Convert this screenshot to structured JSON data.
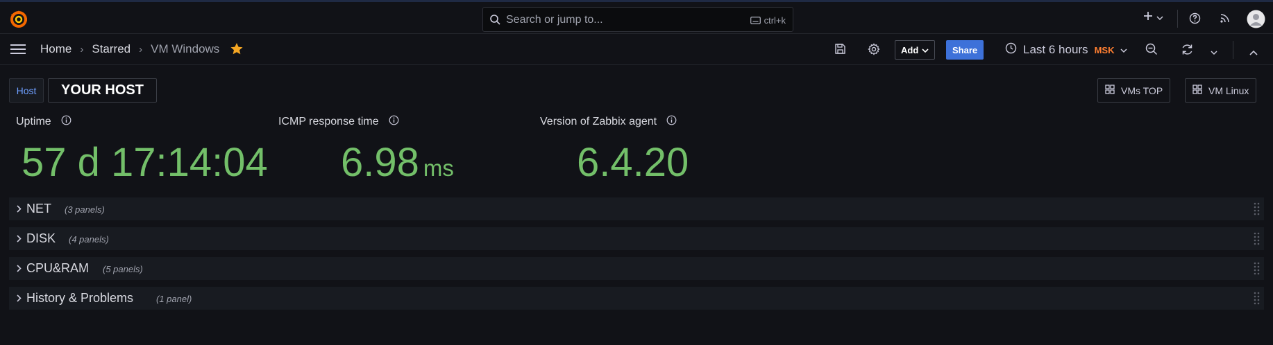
{
  "topbar": {
    "search_placeholder": "Search or jump to...",
    "search_shortcut": "ctrl+k"
  },
  "breadcrumb": {
    "items": [
      "Home",
      "Starred",
      "VM Windows"
    ]
  },
  "toolbar": {
    "add_label": "Add",
    "share_label": "Share",
    "time_range": "Last 6 hours",
    "timezone": "MSK"
  },
  "variables": {
    "host_label": "Host",
    "host_value": "YOUR HOST"
  },
  "links": {
    "vms_top": "VMs TOP",
    "vm_linux": "VM Linux"
  },
  "stats": [
    {
      "title": "Uptime",
      "value": "57 d 17:14:04",
      "unit": ""
    },
    {
      "title": "ICMP response time",
      "value": "6.98",
      "unit": "ms"
    },
    {
      "title": "Version of Zabbix agent",
      "value": "6.4.20",
      "unit": ""
    }
  ],
  "rows": [
    {
      "title": "NET",
      "count": "(3 panels)"
    },
    {
      "title": "DISK",
      "count": "(4 panels)"
    },
    {
      "title": "CPU&RAM",
      "count": "(5 panels)"
    },
    {
      "title": "History & Problems",
      "count": "(1 panel)"
    }
  ],
  "colors": {
    "accent_value": "#73bf69",
    "share_button": "#3d71d9",
    "timezone": "#ff7f31",
    "star": "#f5a623"
  }
}
